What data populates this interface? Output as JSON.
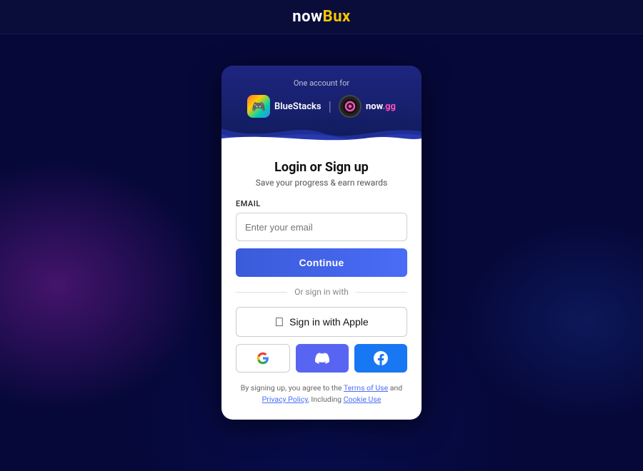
{
  "topbar": {
    "logo_now": "now",
    "logo_bux": "Bux"
  },
  "card": {
    "header": {
      "subtitle": "One account for",
      "brand1_name": "BlueStacks",
      "brand_divider": "|",
      "brand2_name_now": "now",
      "brand2_name_gg": ".gg"
    },
    "body": {
      "title": "Login or Sign up",
      "subtitle": "Save your progress & earn rewards",
      "email_label": "EMAIL",
      "email_placeholder": "Enter your email",
      "continue_label": "Continue",
      "divider_text": "Or sign in with",
      "apple_label": "Sign in with Apple",
      "terms_prefix": "By signing up, you agree to the ",
      "terms_of_use": "Terms of Use",
      "terms_and": " and ",
      "privacy_policy": "Privacy Policy",
      "terms_suffix": ", Including ",
      "cookie_use": "Cookie Use"
    }
  }
}
